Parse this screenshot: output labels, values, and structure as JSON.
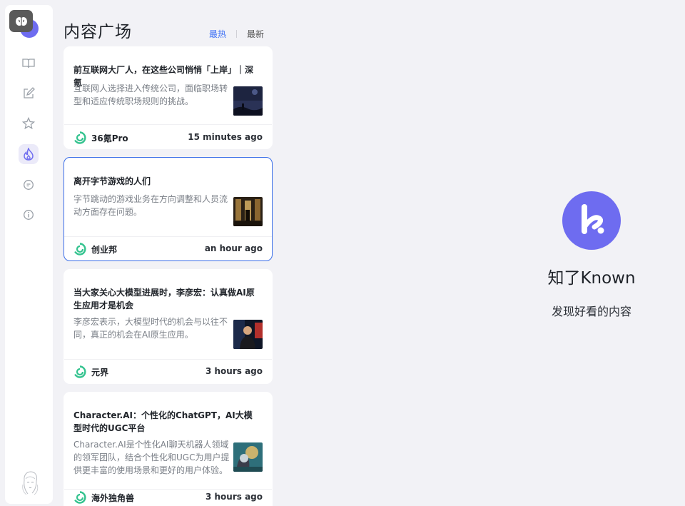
{
  "app": {
    "name": "知了Known",
    "tagline": "发现好看的内容",
    "accent_color": "#6e6cf0"
  },
  "sidebar": {
    "items": [
      {
        "icon": "book-icon",
        "label": "阅读"
      },
      {
        "icon": "edit-icon",
        "label": "写作"
      },
      {
        "icon": "star-icon",
        "label": "收藏"
      },
      {
        "icon": "fire-icon",
        "label": "内容广场",
        "active": true
      },
      {
        "icon": "chat-icon",
        "label": "消息"
      },
      {
        "icon": "info-icon",
        "label": "关于"
      }
    ]
  },
  "feed": {
    "title": "内容广场",
    "tabs": [
      {
        "label": "最热",
        "active": true
      },
      {
        "label": "最新",
        "active": false
      }
    ],
    "cards": [
      {
        "title": "前互联网大厂人，在这些公司悄悄「上岸」｜深氪",
        "summary": "互联网人选择进入传统公司，面临职场转型和适应传统职场规则的挑战。",
        "source": "36氪Pro",
        "time": "15 minutes ago",
        "thumb": "night-sky-image"
      },
      {
        "title": "离开字节游戏的人们",
        "summary": "字节跳动的游戏业务在方向调整和人员流动方面存在问题。",
        "source": "创业邦",
        "time": "an hour ago",
        "thumb": "corridor-image",
        "selected": true
      },
      {
        "title": "当大家关心大模型进展时，李彦宏：认真做AI原生应用才是机会",
        "summary": "李彦宏表示，大模型时代的机会与以往不同，真正的机会在AI原生应用。",
        "source": "元界",
        "time": "3 hours ago",
        "thumb": "speaker-image"
      },
      {
        "title": "Character.AI：个性化的ChatGPT，AI大模型时代的UGC平台",
        "summary": "Character.AI是个性化AI聊天机器人领域的领军团队，结合个性化和UGC为用户提供更丰富的使用场景和更好的用户体验。",
        "source": "海外独角兽",
        "time": "3 hours ago",
        "thumb": "robot-face-image"
      }
    ]
  }
}
